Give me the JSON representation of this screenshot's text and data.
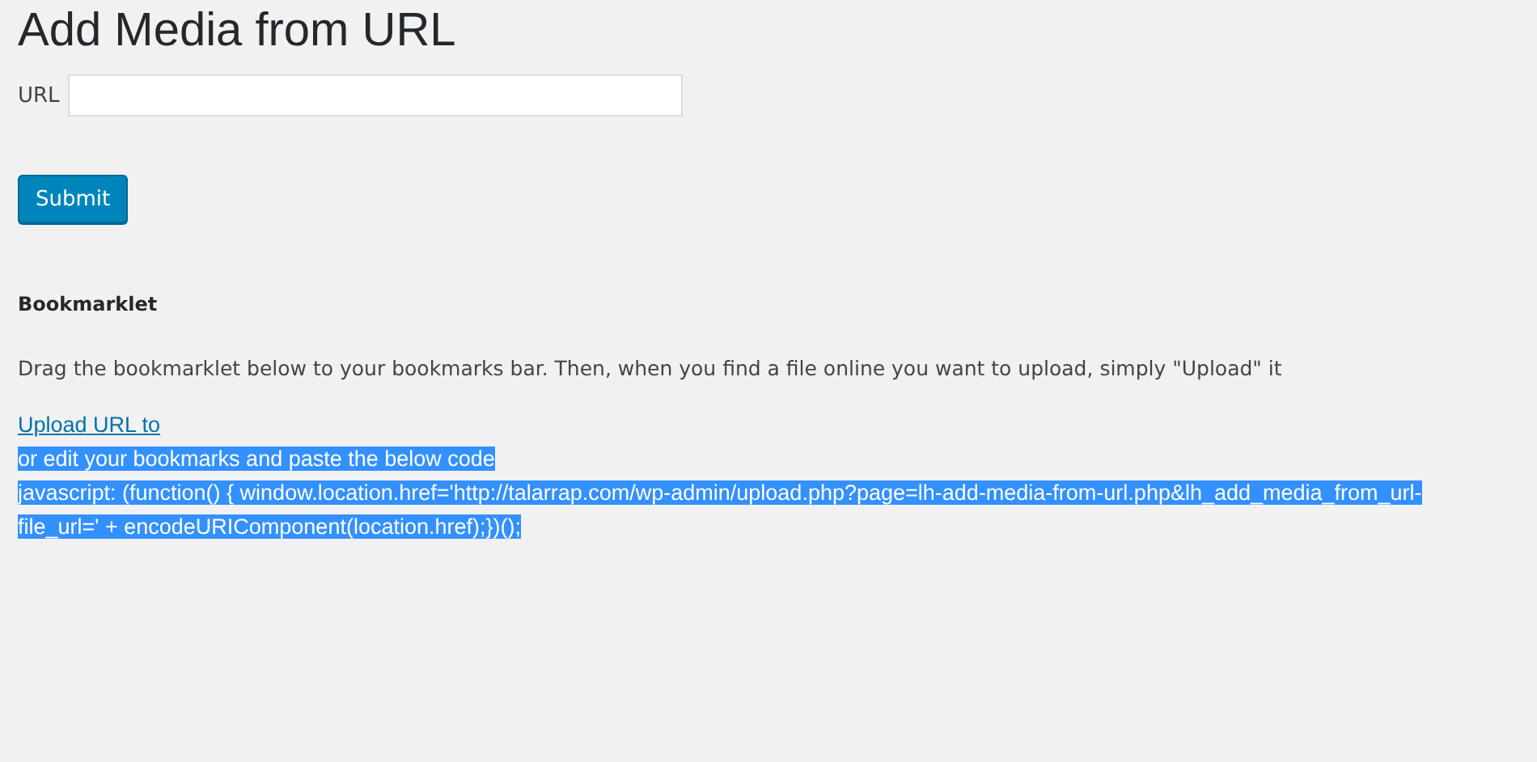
{
  "title": "Add Media from URL",
  "url_field": {
    "label": "URL"
  },
  "submit_button": "Submit",
  "bookmarklet": {
    "heading": "Bookmarklet",
    "instructions": "Drag the bookmarklet below to your bookmarks bar. Then, when you find a file online you want to upload, simply \"Upload\" it",
    "link": "Upload URL to",
    "selection": {
      "highlighted": true,
      "lines": [
        "or edit your bookmarks and paste the below code",
        "javascript: (function() { window.location.href='http://talarrap.com/wp-admin/upload.php?page=lh-add-media-from-url.php&lh_add_media_from_url-",
        "file_url=' + encodeURIComponent(location.href);})();"
      ]
    }
  }
}
